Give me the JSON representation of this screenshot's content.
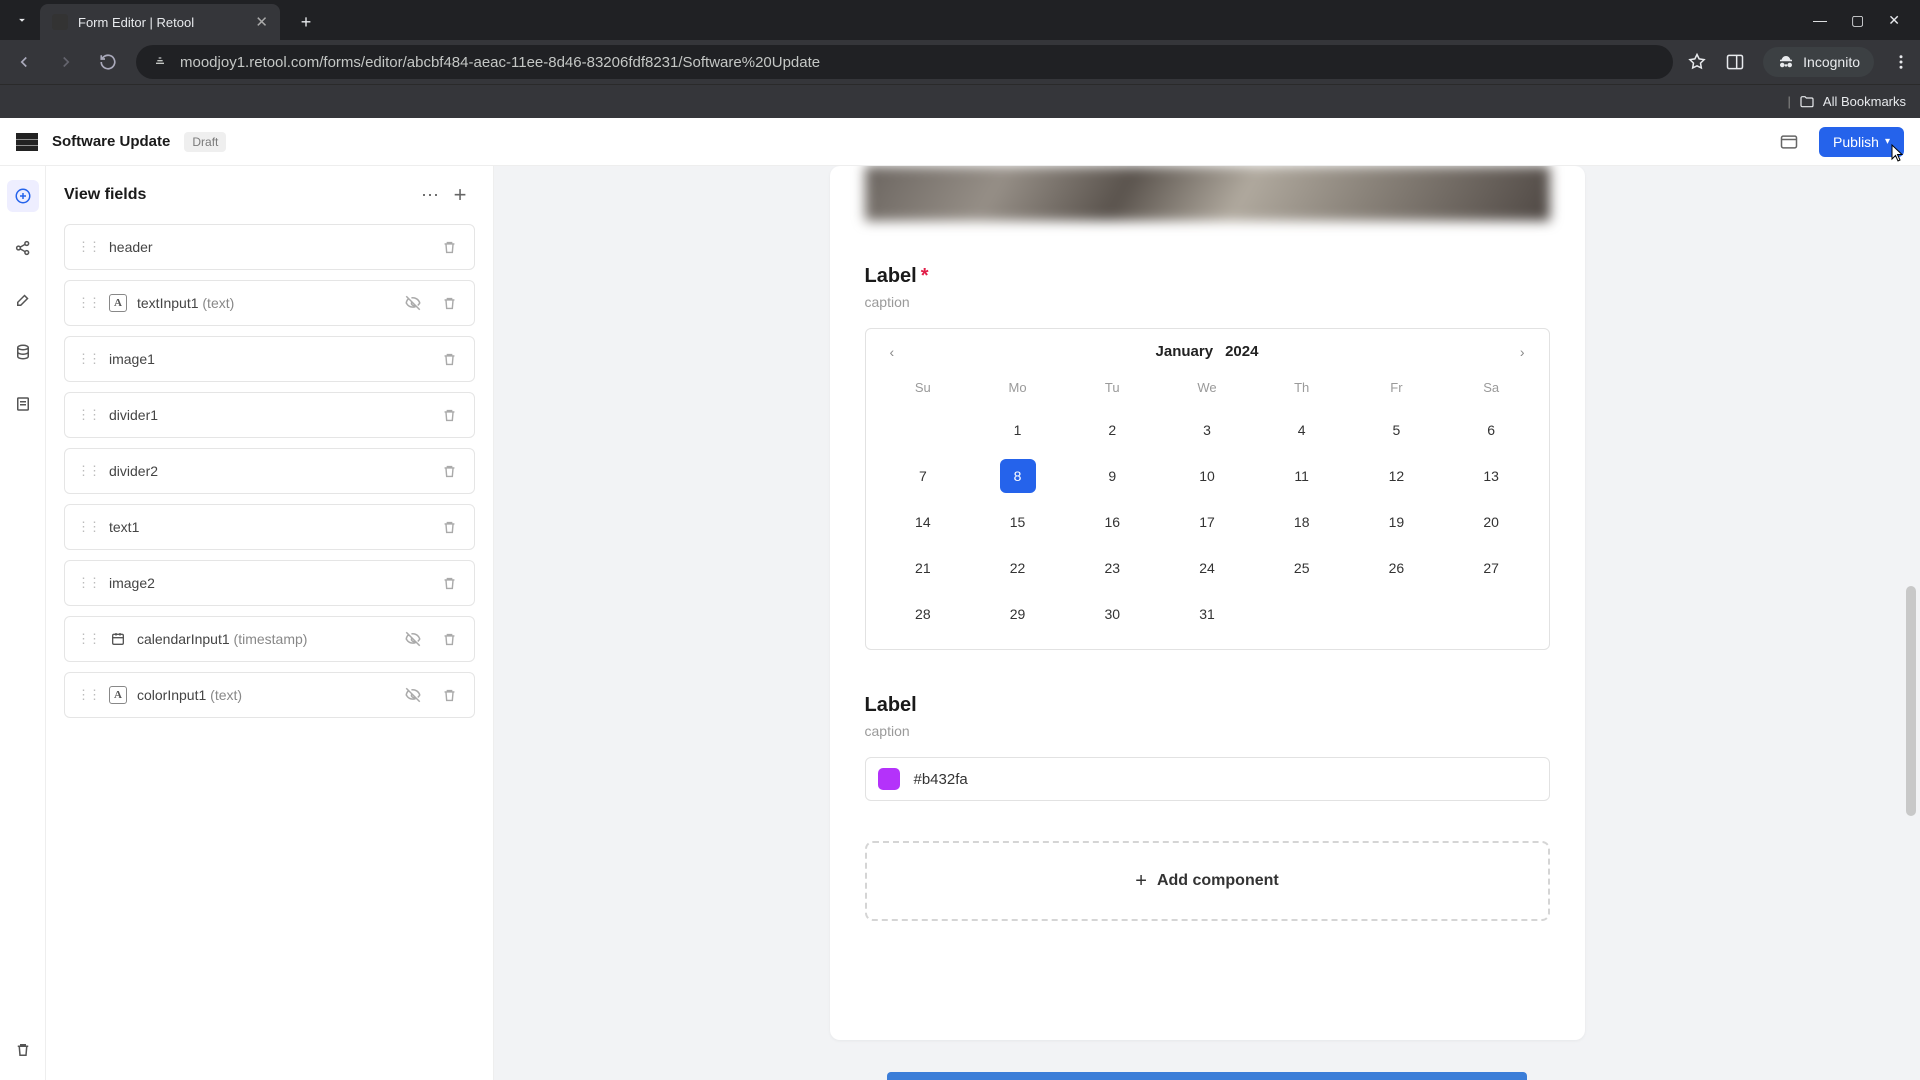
{
  "browser": {
    "tab_title": "Form Editor | Retool",
    "url": "moodjoy1.retool.com/forms/editor/abcbf484-aeac-11ee-8d46-83206fdf8231/Software%20Update",
    "incognito_label": "Incognito",
    "all_bookmarks": "All Bookmarks"
  },
  "header": {
    "title": "Software Update",
    "badge": "Draft",
    "publish": "Publish"
  },
  "sidebar": {
    "title": "View fields",
    "fields": [
      {
        "label": "header"
      },
      {
        "label": "textInput1",
        "sub": "(text)",
        "hideable": true
      },
      {
        "label": "image1"
      },
      {
        "label": "divider1"
      },
      {
        "label": "divider2"
      },
      {
        "label": "text1"
      },
      {
        "label": "image2"
      },
      {
        "label": "calendarInput1",
        "sub": "(timestamp)",
        "hideable": true
      },
      {
        "label": "colorInput1",
        "sub": "(text)",
        "hideable": true
      }
    ]
  },
  "form": {
    "calendar": {
      "label": "Label",
      "caption": "caption",
      "month": "January",
      "year": "2024",
      "dow": [
        "Su",
        "Mo",
        "Tu",
        "We",
        "Th",
        "Fr",
        "Sa"
      ],
      "leading_blanks": 1,
      "days_in_month": 31,
      "selected": 8
    },
    "color": {
      "label": "Label",
      "caption": "caption",
      "value": "#b432fa"
    },
    "add_component": "Add component"
  }
}
